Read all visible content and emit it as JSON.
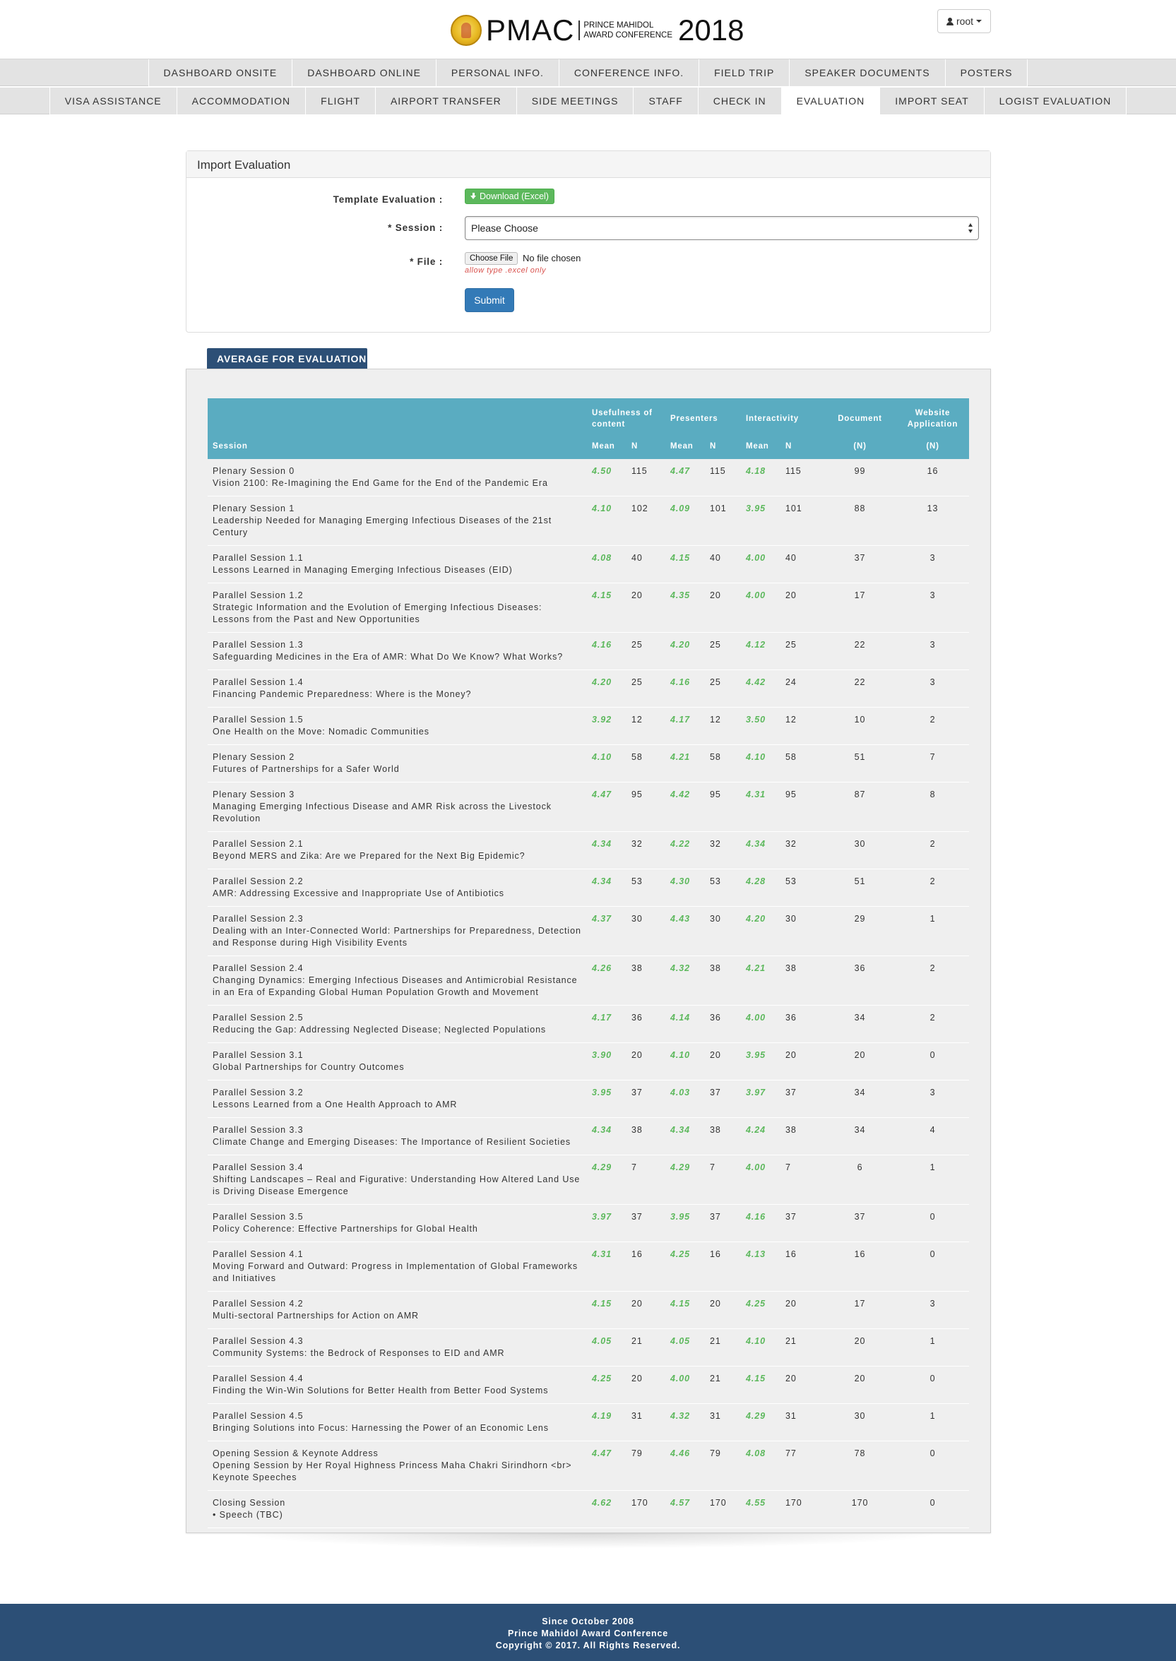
{
  "header": {
    "brand": "PMAC",
    "brand_sub_line1": "PRINCE MAHIDOL",
    "brand_sub_line2": "AWARD CONFERENCE",
    "year": "2018",
    "user_label": "root"
  },
  "nav_row1": [
    "DASHBOARD ONSITE",
    "DASHBOARD ONLINE",
    "PERSONAL INFO.",
    "CONFERENCE INFO.",
    "FIELD TRIP",
    "SPEAKER DOCUMENTS",
    "POSTERS"
  ],
  "nav_row2": [
    "VISA ASSISTANCE",
    "ACCOMMODATION",
    "FLIGHT",
    "AIRPORT TRANSFER",
    "SIDE MEETINGS",
    "STAFF",
    "CHECK IN",
    "EVALUATION",
    "IMPORT SEAT",
    "LOGIST EVALUATION"
  ],
  "nav_active": "EVALUATION",
  "import_panel": {
    "title": "Import Evaluation",
    "template_label": "Template Evaluation :",
    "download_label": "Download (Excel)",
    "session_label": "* Session :",
    "session_value": "Please Choose",
    "file_label": "* File :",
    "file_button": "Choose File",
    "file_status": "No file chosen",
    "file_hint": "allow type .excel only",
    "submit_label": "Submit"
  },
  "average": {
    "tab_label": "AVERAGE FOR EVALUATION",
    "headers": {
      "session": "Session",
      "usefulness": "Usefulness of content",
      "presenters": "Presenters",
      "interactivity": "Interactivity",
      "document": "Document",
      "website": "Website Application",
      "mean": "Mean",
      "n": "N",
      "n_paren": "(N)"
    },
    "rows": [
      {
        "title": "Plenary Session 0",
        "subtitle": "Vision 2100: Re-Imagining the End Game for the End of the Pandemic Era",
        "u_mean": "4.50",
        "u_n": "115",
        "p_mean": "4.47",
        "p_n": "115",
        "i_mean": "4.18",
        "i_n": "115",
        "doc": "99",
        "web": "16"
      },
      {
        "title": "Plenary Session 1",
        "subtitle": "Leadership Needed for Managing Emerging Infectious Diseases of the 21st Century",
        "u_mean": "4.10",
        "u_n": "102",
        "p_mean": "4.09",
        "p_n": "101",
        "i_mean": "3.95",
        "i_n": "101",
        "doc": "88",
        "web": "13"
      },
      {
        "title": "Parallel Session 1.1",
        "subtitle": "Lessons Learned in Managing Emerging Infectious Diseases (EID)",
        "u_mean": "4.08",
        "u_n": "40",
        "p_mean": "4.15",
        "p_n": "40",
        "i_mean": "4.00",
        "i_n": "40",
        "doc": "37",
        "web": "3"
      },
      {
        "title": "Parallel Session 1.2",
        "subtitle": "Strategic Information and the Evolution of Emerging Infectious Diseases: Lessons from the Past and New Opportunities",
        "u_mean": "4.15",
        "u_n": "20",
        "p_mean": "4.35",
        "p_n": "20",
        "i_mean": "4.00",
        "i_n": "20",
        "doc": "17",
        "web": "3"
      },
      {
        "title": "Parallel Session 1.3",
        "subtitle": "Safeguarding Medicines in the Era of AMR: What Do We Know? What Works?",
        "u_mean": "4.16",
        "u_n": "25",
        "p_mean": "4.20",
        "p_n": "25",
        "i_mean": "4.12",
        "i_n": "25",
        "doc": "22",
        "web": "3"
      },
      {
        "title": "Parallel Session 1.4",
        "subtitle": "Financing Pandemic Preparedness: Where is the Money?",
        "u_mean": "4.20",
        "u_n": "25",
        "p_mean": "4.16",
        "p_n": "25",
        "i_mean": "4.42",
        "i_n": "24",
        "doc": "22",
        "web": "3"
      },
      {
        "title": "Parallel Session 1.5",
        "subtitle": "One Health on the Move: Nomadic Communities",
        "u_mean": "3.92",
        "u_n": "12",
        "p_mean": "4.17",
        "p_n": "12",
        "i_mean": "3.50",
        "i_n": "12",
        "doc": "10",
        "web": "2"
      },
      {
        "title": "Plenary Session 2",
        "subtitle": "Futures of Partnerships for a Safer World",
        "u_mean": "4.10",
        "u_n": "58",
        "p_mean": "4.21",
        "p_n": "58",
        "i_mean": "4.10",
        "i_n": "58",
        "doc": "51",
        "web": "7"
      },
      {
        "title": "Plenary Session 3",
        "subtitle": "Managing Emerging Infectious Disease and AMR Risk across the Livestock Revolution",
        "u_mean": "4.47",
        "u_n": "95",
        "p_mean": "4.42",
        "p_n": "95",
        "i_mean": "4.31",
        "i_n": "95",
        "doc": "87",
        "web": "8"
      },
      {
        "title": "Parallel Session 2.1",
        "subtitle": "Beyond MERS and Zika: Are we Prepared for the Next Big Epidemic?",
        "u_mean": "4.34",
        "u_n": "32",
        "p_mean": "4.22",
        "p_n": "32",
        "i_mean": "4.34",
        "i_n": "32",
        "doc": "30",
        "web": "2"
      },
      {
        "title": "Parallel Session 2.2",
        "subtitle": "AMR: Addressing Excessive and Inappropriate Use of Antibiotics",
        "u_mean": "4.34",
        "u_n": "53",
        "p_mean": "4.30",
        "p_n": "53",
        "i_mean": "4.28",
        "i_n": "53",
        "doc": "51",
        "web": "2"
      },
      {
        "title": "Parallel Session 2.3",
        "subtitle": "Dealing with an Inter-Connected World: Partnerships for Preparedness, Detection and Response during High Visibility Events",
        "u_mean": "4.37",
        "u_n": "30",
        "p_mean": "4.43",
        "p_n": "30",
        "i_mean": "4.20",
        "i_n": "30",
        "doc": "29",
        "web": "1"
      },
      {
        "title": "Parallel Session 2.4",
        "subtitle": "Changing Dynamics: Emerging Infectious Diseases and Antimicrobial Resistance in an Era of Expanding Global Human Population Growth and Movement",
        "u_mean": "4.26",
        "u_n": "38",
        "p_mean": "4.32",
        "p_n": "38",
        "i_mean": "4.21",
        "i_n": "38",
        "doc": "36",
        "web": "2"
      },
      {
        "title": "Parallel Session 2.5",
        "subtitle": "Reducing the Gap: Addressing Neglected Disease; Neglected Populations",
        "u_mean": "4.17",
        "u_n": "36",
        "p_mean": "4.14",
        "p_n": "36",
        "i_mean": "4.00",
        "i_n": "36",
        "doc": "34",
        "web": "2"
      },
      {
        "title": "Parallel Session 3.1",
        "subtitle": "Global Partnerships for Country Outcomes",
        "u_mean": "3.90",
        "u_n": "20",
        "p_mean": "4.10",
        "p_n": "20",
        "i_mean": "3.95",
        "i_n": "20",
        "doc": "20",
        "web": "0"
      },
      {
        "title": "Parallel Session 3.2",
        "subtitle": "Lessons Learned from a One Health Approach to AMR",
        "u_mean": "3.95",
        "u_n": "37",
        "p_mean": "4.03",
        "p_n": "37",
        "i_mean": "3.97",
        "i_n": "37",
        "doc": "34",
        "web": "3"
      },
      {
        "title": "Parallel Session 3.3",
        "subtitle": "Climate Change and Emerging Diseases: The Importance of Resilient Societies",
        "u_mean": "4.34",
        "u_n": "38",
        "p_mean": "4.34",
        "p_n": "38",
        "i_mean": "4.24",
        "i_n": "38",
        "doc": "34",
        "web": "4"
      },
      {
        "title": "Parallel Session 3.4",
        "subtitle": "Shifting Landscapes – Real and Figurative: Understanding How Altered Land Use is Driving Disease Emergence",
        "u_mean": "4.29",
        "u_n": "7",
        "p_mean": "4.29",
        "p_n": "7",
        "i_mean": "4.00",
        "i_n": "7",
        "doc": "6",
        "web": "1"
      },
      {
        "title": "Parallel Session 3.5",
        "subtitle": "Policy Coherence: Effective Partnerships for Global Health",
        "u_mean": "3.97",
        "u_n": "37",
        "p_mean": "3.95",
        "p_n": "37",
        "i_mean": "4.16",
        "i_n": "37",
        "doc": "37",
        "web": "0"
      },
      {
        "title": "Parallel Session 4.1",
        "subtitle": "Moving Forward and Outward: Progress in Implementation of Global Frameworks and Initiatives",
        "u_mean": "4.31",
        "u_n": "16",
        "p_mean": "4.25",
        "p_n": "16",
        "i_mean": "4.13",
        "i_n": "16",
        "doc": "16",
        "web": "0"
      },
      {
        "title": "Parallel Session 4.2",
        "subtitle": "Multi-sectoral Partnerships for Action on AMR",
        "u_mean": "4.15",
        "u_n": "20",
        "p_mean": "4.15",
        "p_n": "20",
        "i_mean": "4.25",
        "i_n": "20",
        "doc": "17",
        "web": "3"
      },
      {
        "title": "Parallel Session 4.3",
        "subtitle": "Community Systems: the Bedrock of Responses to EID and AMR",
        "u_mean": "4.05",
        "u_n": "21",
        "p_mean": "4.05",
        "p_n": "21",
        "i_mean": "4.10",
        "i_n": "21",
        "doc": "20",
        "web": "1"
      },
      {
        "title": "Parallel Session 4.4",
        "subtitle": "Finding the Win-Win Solutions for Better Health from Better Food Systems",
        "u_mean": "4.25",
        "u_n": "20",
        "p_mean": "4.00",
        "p_n": "21",
        "i_mean": "4.15",
        "i_n": "20",
        "doc": "20",
        "web": "0"
      },
      {
        "title": "Parallel Session 4.5",
        "subtitle": "Bringing Solutions into Focus: Harnessing the Power of an Economic Lens",
        "u_mean": "4.19",
        "u_n": "31",
        "p_mean": "4.32",
        "p_n": "31",
        "i_mean": "4.29",
        "i_n": "31",
        "doc": "30",
        "web": "1"
      },
      {
        "title": "Opening Session & Keynote Address",
        "subtitle": "Opening Session by Her Royal Highness Princess Maha Chakri Sirindhorn <br> Keynote Speeches",
        "u_mean": "4.47",
        "u_n": "79",
        "p_mean": "4.46",
        "p_n": "79",
        "i_mean": "4.08",
        "i_n": "77",
        "doc": "78",
        "web": "0"
      },
      {
        "title": "Closing Session",
        "subtitle": "• Speech (TBC)",
        "u_mean": "4.62",
        "u_n": "170",
        "p_mean": "4.57",
        "p_n": "170",
        "i_mean": "4.55",
        "i_n": "170",
        "doc": "170",
        "web": "0"
      }
    ]
  },
  "footer": {
    "line1": "Since October 2008",
    "line2": "Prince Mahidol Award Conference",
    "line3": "Copyright © 2017. All Rights Reserved."
  },
  "colors": {
    "header_teal": "#5aacc1",
    "navy": "#2c4f76",
    "mean_green": "#5cb85c",
    "primary_blue": "#337ab7"
  }
}
